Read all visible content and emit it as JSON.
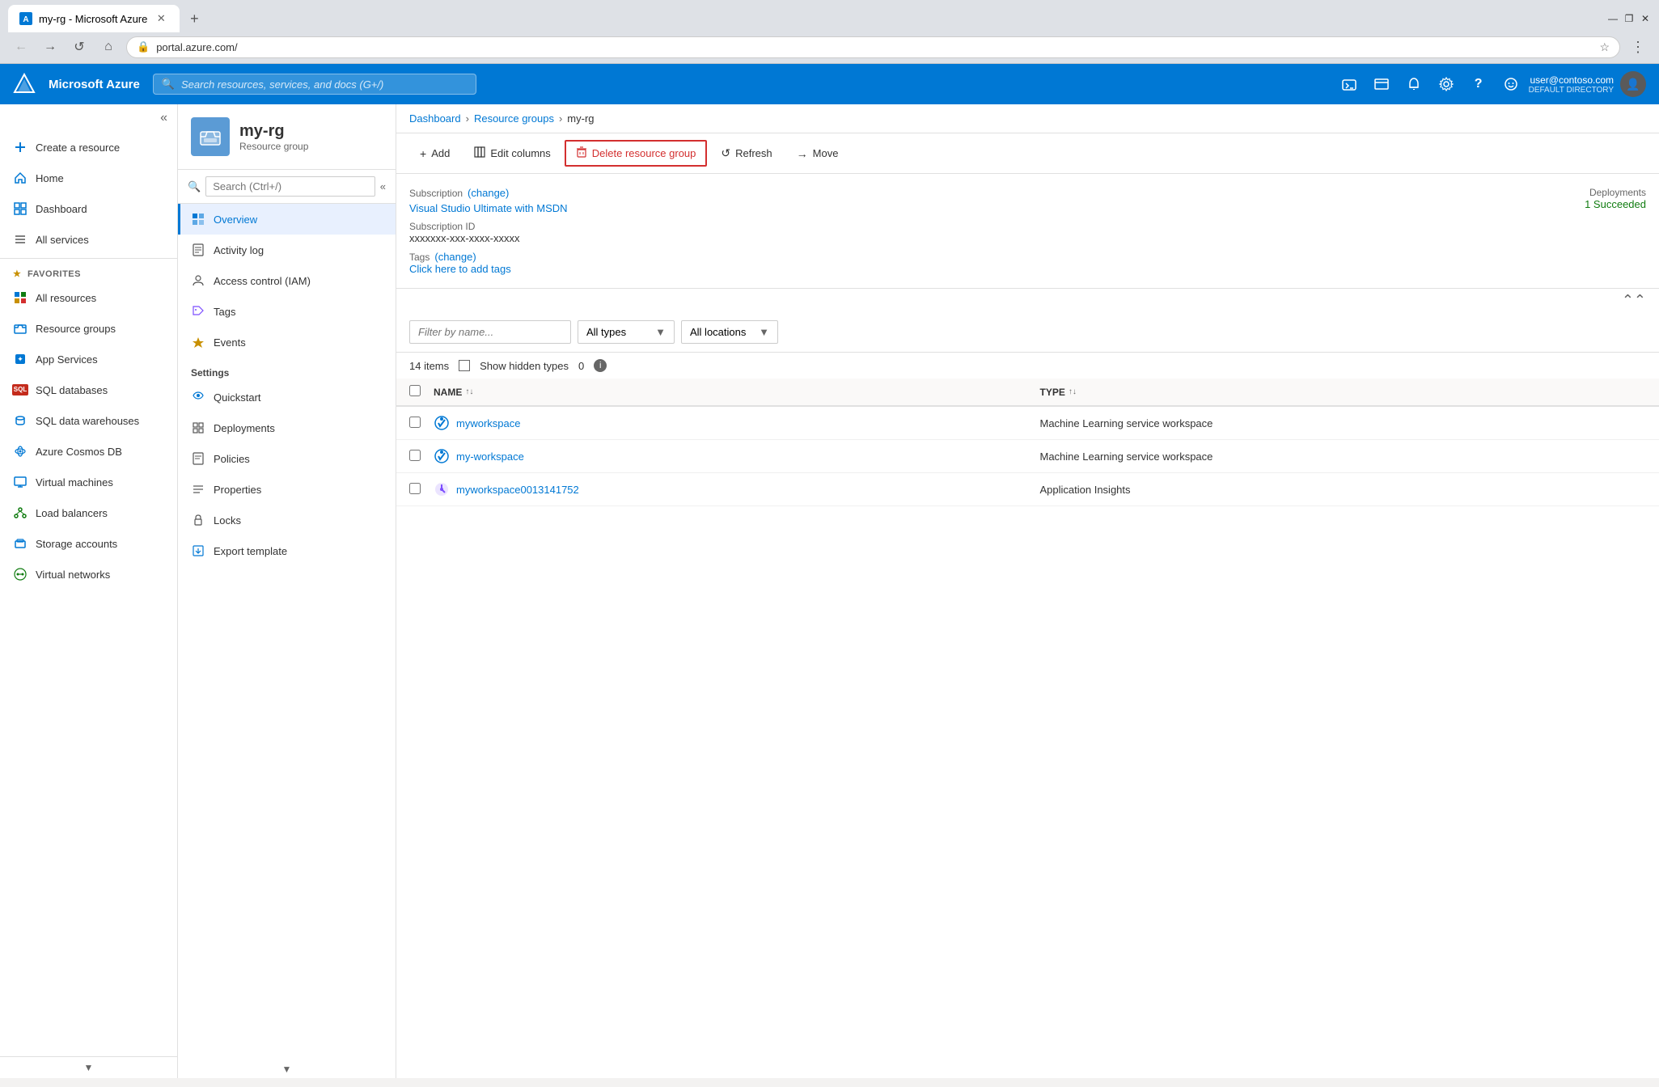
{
  "browser": {
    "tab_title": "my-rg - Microsoft Azure",
    "tab_favicon": "A",
    "url": "portal.azure.com/",
    "new_tab_icon": "+",
    "window_controls": [
      "—",
      "❐",
      "✕"
    ]
  },
  "azure_header": {
    "logo_text": "Microsoft Azure",
    "search_placeholder": "Search resources, services, and docs (G+/)",
    "user_email": "user@contoso.com",
    "user_directory": "DEFAULT DIRECTORY",
    "icons": [
      "▶",
      "📋",
      "🔔",
      "⚙",
      "?",
      "☺"
    ]
  },
  "sidebar": {
    "collapse_icon": "«",
    "create_label": "Create a resource",
    "home_label": "Home",
    "dashboard_label": "Dashboard",
    "all_services_label": "All services",
    "favorites_label": "FAVORITES",
    "nav_items": [
      {
        "label": "All resources",
        "icon": "⊞"
      },
      {
        "label": "Resource groups",
        "icon": "🗂"
      },
      {
        "label": "App Services",
        "icon": "🌐"
      },
      {
        "label": "SQL databases",
        "icon": "SQL"
      },
      {
        "label": "SQL data warehouses",
        "icon": "🗄"
      },
      {
        "label": "Azure Cosmos DB",
        "icon": "◆"
      },
      {
        "label": "Virtual machines",
        "icon": "🖥"
      },
      {
        "label": "Load balancers",
        "icon": "⟺"
      },
      {
        "label": "Storage accounts",
        "icon": "🗄"
      },
      {
        "label": "Virtual networks",
        "icon": "🌐"
      }
    ]
  },
  "breadcrumb": {
    "items": [
      "Dashboard",
      "Resource groups",
      "my-rg"
    ],
    "separators": [
      ">",
      ">"
    ]
  },
  "resource_header": {
    "name": "my-rg",
    "type": "Resource group"
  },
  "panel_nav": {
    "search_placeholder": "Search (Ctrl+/)",
    "items": [
      {
        "label": "Overview",
        "icon": "⊙",
        "active": true
      },
      {
        "label": "Activity log",
        "icon": "📋"
      },
      {
        "label": "Access control (IAM)",
        "icon": "👤"
      },
      {
        "label": "Tags",
        "icon": "🏷"
      },
      {
        "label": "Events",
        "icon": "⚡"
      }
    ],
    "settings_label": "Settings",
    "settings_items": [
      {
        "label": "Quickstart",
        "icon": "☁"
      },
      {
        "label": "Deployments",
        "icon": "⊞"
      },
      {
        "label": "Policies",
        "icon": "📄"
      },
      {
        "label": "Properties",
        "icon": "≡"
      },
      {
        "label": "Locks",
        "icon": "🔒"
      },
      {
        "label": "Export template",
        "icon": "📦"
      }
    ]
  },
  "toolbar": {
    "add_label": "Add",
    "edit_columns_label": "Edit columns",
    "delete_label": "Delete resource group",
    "refresh_label": "Refresh",
    "move_label": "Move"
  },
  "details": {
    "subscription_label": "Subscription",
    "subscription_change": "(change)",
    "subscription_value": "Visual Studio Ultimate with MSDN",
    "subscription_id_label": "Subscription ID",
    "subscription_id_value": "xxxxxxx-xxx-xxxx-xxxxx",
    "tags_label": "Tags",
    "tags_change": "(change)",
    "tags_add": "Click here to add tags",
    "deployments_label": "Deployments",
    "deployments_value": "1 Succeeded"
  },
  "resources": {
    "filter_placeholder": "Filter by name...",
    "all_types_label": "All types",
    "all_locations_label": "All locations",
    "count_label": "14 items",
    "show_hidden_label": "Show hidden types",
    "show_hidden_count": "0",
    "col_name": "NAME",
    "col_type": "TYPE",
    "rows": [
      {
        "name": "myworkspace",
        "type": "Machine Learning service workspace",
        "icon_color": "#0078d4"
      },
      {
        "name": "my-workspace",
        "type": "Machine Learning service workspace",
        "icon_color": "#0078d4"
      },
      {
        "name": "myworkspace0013141752",
        "type": "Application Insights",
        "icon_color": "#7c4dff"
      }
    ]
  }
}
